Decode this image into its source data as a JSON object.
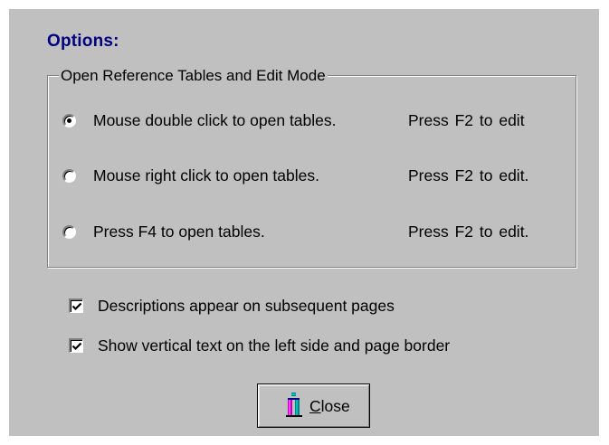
{
  "dialog": {
    "title": "Options:",
    "group": {
      "legend": "Open Reference Tables and Edit Mode",
      "radios": [
        {
          "label": "Mouse double click to open tables.",
          "hint": "Press  F2 to edit",
          "selected": true
        },
        {
          "label": "Mouse right click to open tables.",
          "hint": "Press  F2 to edit.",
          "selected": false
        },
        {
          "label": "Press F4 to open tables.",
          "hint": "Press  F2 to edit.",
          "selected": false
        }
      ]
    },
    "checkboxes": [
      {
        "label": "Descriptions appear on subsequent pages",
        "checked": true
      },
      {
        "label": "Show vertical text on the left side and page border",
        "checked": true
      }
    ],
    "close_button": {
      "mnemonic": "C",
      "rest": "lose",
      "icon": "door-exit-icon"
    }
  },
  "colors": {
    "dialog_bg": "#c0c0c0",
    "title": "#000080",
    "icon_magenta": "#c000c0",
    "icon_teal": "#008080"
  }
}
